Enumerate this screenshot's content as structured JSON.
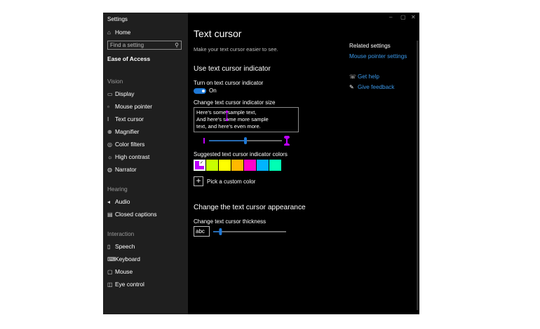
{
  "window": {
    "title": "Settings",
    "controls": {
      "minimize": "–",
      "maximize": "▢",
      "close": "✕"
    }
  },
  "sidebar": {
    "home": {
      "icon": "home-icon",
      "label": "Home"
    },
    "search": {
      "placeholder": "Find a setting"
    },
    "category": "Ease of Access",
    "sections": [
      {
        "title": "Vision",
        "items": [
          {
            "icon": "display-icon",
            "label": "Display"
          },
          {
            "icon": "mouse-pointer-icon",
            "label": "Mouse pointer"
          },
          {
            "icon": "text-cursor-icon",
            "label": "Text cursor",
            "selected": true
          },
          {
            "icon": "magnifier-icon",
            "label": "Magnifier"
          },
          {
            "icon": "color-filters-icon",
            "label": "Color filters"
          },
          {
            "icon": "high-contrast-icon",
            "label": "High contrast"
          },
          {
            "icon": "narrator-icon",
            "label": "Narrator"
          }
        ]
      },
      {
        "title": "Hearing",
        "items": [
          {
            "icon": "audio-icon",
            "label": "Audio"
          },
          {
            "icon": "closed-captions-icon",
            "label": "Closed captions"
          }
        ]
      },
      {
        "title": "Interaction",
        "items": [
          {
            "icon": "speech-icon",
            "label": "Speech"
          },
          {
            "icon": "keyboard-icon",
            "label": "Keyboard"
          },
          {
            "icon": "mouse-icon",
            "label": "Mouse"
          },
          {
            "icon": "eye-control-icon",
            "label": "Eye control"
          }
        ]
      }
    ]
  },
  "main": {
    "title": "Text cursor",
    "subtitle": "Make your text cursor easier to see.",
    "indicator": {
      "heading": "Use text cursor indicator",
      "toggle_label": "Turn on text cursor indicator",
      "toggle_state": "On",
      "size_label": "Change text cursor indicator size",
      "size_level": 0.5,
      "sample_lines": [
        "Here's some sample text,",
        "And here's some more sample",
        "text, and here's even more."
      ],
      "colors_label": "Suggested text cursor indicator colors",
      "colors": [
        "#bf00ff",
        "#c8ff00",
        "#ffff00",
        "#ffb900",
        "#ff00cc",
        "#00b4ff",
        "#00ffb4"
      ],
      "selected_color": "#bf00ff",
      "custom_label": "Pick a custom color"
    },
    "appearance": {
      "heading": "Change the text cursor appearance",
      "thickness_label": "Change text cursor thickness",
      "preview": "abc",
      "thickness_level": 0.1
    }
  },
  "related": {
    "title": "Related settings",
    "link": "Mouse pointer settings",
    "help": [
      {
        "icon": "get-help-icon",
        "label": "Get help"
      },
      {
        "icon": "give-feedback-icon",
        "label": "Give feedback"
      }
    ]
  }
}
